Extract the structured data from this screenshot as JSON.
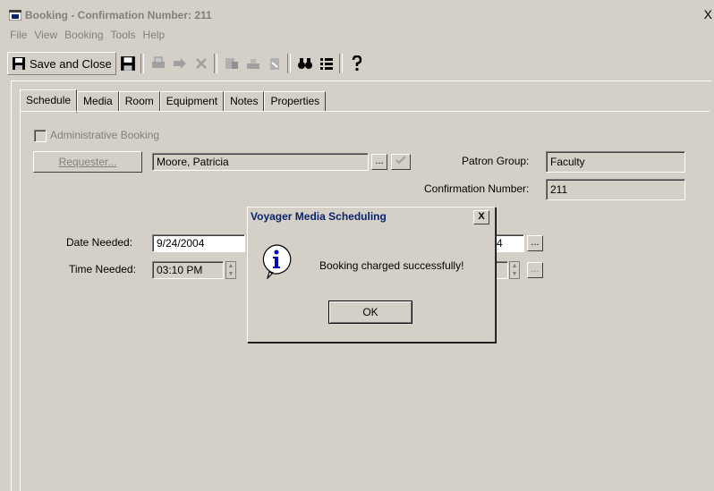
{
  "window": {
    "title": "Booking - Confirmation Number: 211",
    "close": "X"
  },
  "menu": [
    "File",
    "View",
    "Booking",
    "Tools",
    "Help"
  ],
  "toolbar": {
    "save_close_label": "Save and Close"
  },
  "tabs": [
    "Schedule",
    "Media",
    "Room",
    "Equipment",
    "Notes",
    "Properties"
  ],
  "form": {
    "admin_booking_label": "Administrative Booking",
    "requester_button": "Requester...",
    "requester_value": "Moore, Patricia",
    "patron_group_label": "Patron Group:",
    "patron_group_value": "Faculty",
    "confirmation_label": "Confirmation Number:",
    "confirmation_value": "211",
    "date_needed_label": "Date Needed:",
    "date_needed_value": "9/24/2004",
    "date_end_partial": "4",
    "time_needed_label": "Time Needed:",
    "time_needed_value": "03:10 PM",
    "ellipsis": "..."
  },
  "dialog": {
    "title": "Voyager Media Scheduling",
    "close": "X",
    "message": "Booking charged successfully!",
    "ok_label": "OK",
    "icon": "info-icon"
  }
}
